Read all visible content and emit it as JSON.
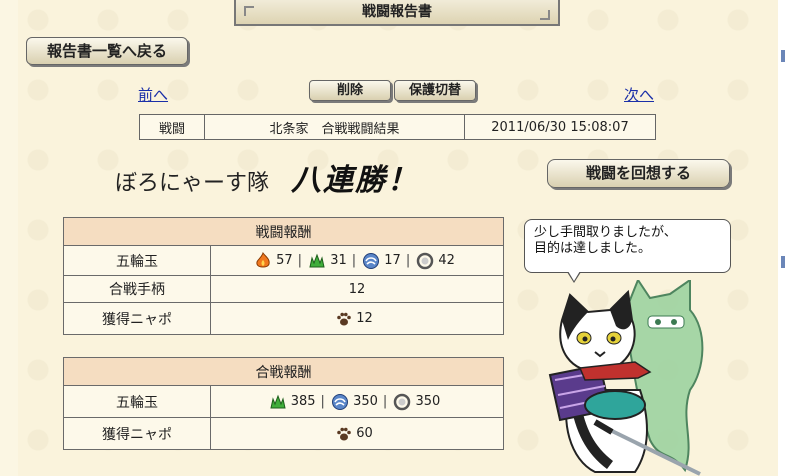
{
  "title": "戦闘報告書",
  "back_button": "報告書一覧へ戻る",
  "nav": {
    "prev": "前へ",
    "next": "次へ",
    "delete": "削除",
    "protect": "保護切替"
  },
  "info": {
    "type": "戦闘",
    "description": "北条家　合戦戦闘結果",
    "datetime": "2011/06/30 15:08:07"
  },
  "result": {
    "team": "ぼろにゃーす隊",
    "victory": "八連勝！"
  },
  "recall_button": "戦闘を回想する",
  "battle_reward": {
    "header": "戦闘報酬",
    "rows": {
      "gems_label": "五輪玉",
      "gems": {
        "fire": "57",
        "earth": "31",
        "wind": "17",
        "void": "42"
      },
      "merit_label": "合戦手柄",
      "merit_value": "12",
      "nyapo_label": "獲得ニャポ",
      "nyapo_value": "12"
    }
  },
  "war_reward": {
    "header": "合戦報酬",
    "rows": {
      "gems_label": "五輪玉",
      "gems": {
        "earth": "385",
        "wind": "350",
        "void": "350"
      },
      "nyapo_label": "獲得ニャポ",
      "nyapo_value": "60"
    }
  },
  "speech": {
    "line1": "少し手間取りましたが、",
    "line2": "目的は達しました。"
  },
  "icons": [
    "fire-gem-icon",
    "earth-gem-icon",
    "wind-gem-icon",
    "void-gem-icon",
    "paw-icon"
  ],
  "colors": {
    "background": "#faf3dc",
    "header_cell": "#f5ddc1",
    "link": "#1a2fa8"
  }
}
